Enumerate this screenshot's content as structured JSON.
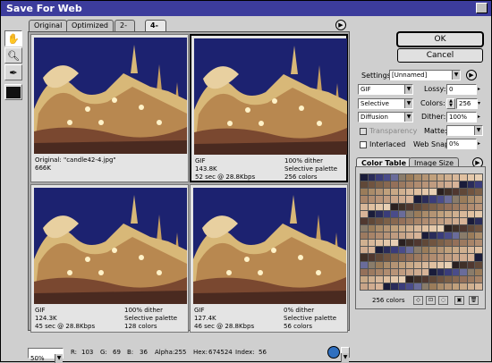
{
  "window": {
    "title": "Save For Web"
  },
  "tabs": [
    {
      "label": "Original",
      "active": false
    },
    {
      "label": "Optimized",
      "active": false
    },
    {
      "label": "2-Up",
      "active": false
    },
    {
      "label": "4-Up",
      "active": true
    }
  ],
  "panes": [
    {
      "lines_left": [
        "Original: \"candle42-4.jpg\"",
        "666K"
      ],
      "lines_right": [],
      "selected": false
    },
    {
      "lines_left": [
        "GIF",
        "143.8K",
        "52 sec @ 28.8Kbps"
      ],
      "lines_right": [
        "100% dither",
        "Selective palette",
        "256 colors"
      ],
      "selected": true
    },
    {
      "lines_left": [
        "GIF",
        "124.3K",
        "45 sec @ 28.8Kbps"
      ],
      "lines_right": [
        "100% dither",
        "Selective palette",
        "128 colors"
      ],
      "selected": false
    },
    {
      "lines_left": [
        "GIF",
        "127.4K",
        "46 sec @ 28.8Kbps"
      ],
      "lines_right": [
        "0% dither",
        "Selective palette",
        "56 colors"
      ],
      "selected": false
    }
  ],
  "buttons": {
    "ok": "OK",
    "cancel": "Cancel"
  },
  "settings": {
    "label": "Settings:",
    "preset": "[Unnamed]",
    "format": "GIF",
    "reduction": "Selective",
    "dither_algo": "Diffusion",
    "lossy_label": "Lossy:",
    "lossy_value": "0",
    "colors_label": "Colors:",
    "colors_value": "256",
    "dither_label": "Dither:",
    "dither_value": "100%",
    "matte_label": "Matte:",
    "transparency_label": "Transparency",
    "interlaced_label": "Interlaced",
    "websnap_label": "Web Snap:",
    "websnap_value": "0%"
  },
  "color_table": {
    "tab_active": "Color Table",
    "tab_other": "Image Size",
    "count_label": "256 colors"
  },
  "status": {
    "zoom": "50%",
    "r_label": "R:",
    "r": "103",
    "g_label": "G:",
    "g": "69",
    "b_label": "B:",
    "b": "36",
    "alpha_label": "Alpha:",
    "alpha": "255",
    "hex_label": "Hex:",
    "hex": "674524",
    "index_label": "Index:",
    "index": "56"
  },
  "colors": {
    "titlebar": "#3c3c9c",
    "sky": "#1c2270",
    "sculpture": "#d8b878"
  },
  "palette": [
    "#1a1c3a",
    "#2a2c5a",
    "#3a3c7a",
    "#4a4c8a",
    "#6a6c9a",
    "#8a7c6a",
    "#9a7c5a",
    "#aa8c6a",
    "#b49474",
    "#c0a07c",
    "#c8a886",
    "#d0b090",
    "#d8b89a",
    "#e0c0a0",
    "#e4c8aa",
    "#e8d0b4",
    "#2a2020",
    "#403028",
    "#503830",
    "#604838",
    "#705440",
    "#7c6048",
    "#886850",
    "#94705a",
    "#9c7a60",
    "#a88468",
    "#b08c70",
    "#b89478",
    "#c09c80",
    "#c8a488",
    "#d0ac90",
    "#d8b498"
  ]
}
